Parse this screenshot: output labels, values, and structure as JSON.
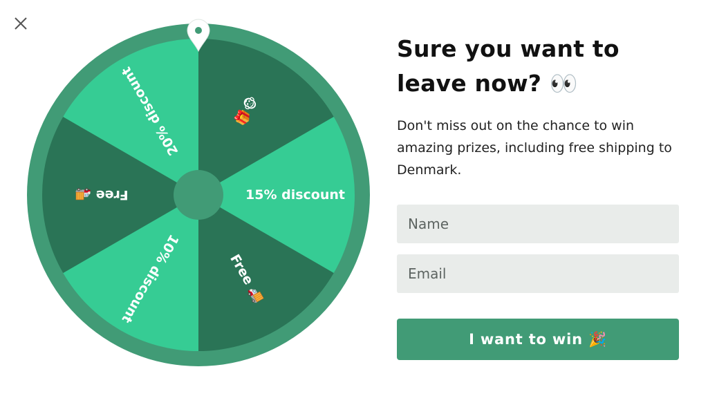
{
  "close": {
    "icon": "close-icon"
  },
  "wheel": {
    "pointer_icon": "map-pin-icon",
    "rim_color": "#419b76",
    "light_color": "#36cc94",
    "dark_color": "#2a7456",
    "segments": [
      {
        "label": "🎁🐵",
        "shade": "dark"
      },
      {
        "label": "15% discount",
        "shade": "light"
      },
      {
        "label": "Free 🚚",
        "shade": "dark"
      },
      {
        "label": "10% discount",
        "shade": "light"
      },
      {
        "label": "Free 🚚",
        "shade": "dark"
      },
      {
        "label": "20% discount",
        "shade": "light"
      }
    ]
  },
  "panel": {
    "headline_line1": "Sure you want to",
    "headline_line2": "leave now? 👀",
    "subtext": "Don't miss out on the chance to win amazing prizes, including free shipping to Denmark."
  },
  "form": {
    "name_placeholder": "Name",
    "email_placeholder": "Email",
    "submit_label": "I want to win 🎉",
    "button_color": "#419b76"
  }
}
